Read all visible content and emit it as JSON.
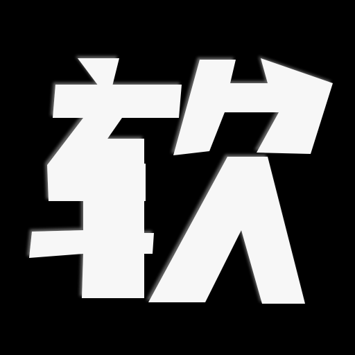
{
  "icon": {
    "character": "软",
    "background_color": "#000000",
    "glyph_color": "#f7f7f7",
    "shadow_color": "#6f6f6f"
  }
}
